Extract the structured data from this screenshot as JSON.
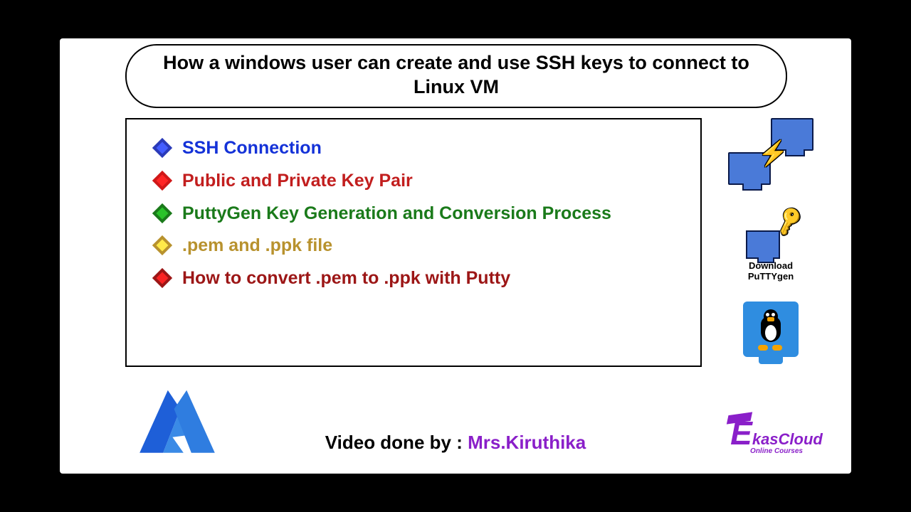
{
  "title": "How a windows user can create and use SSH keys to connect to Linux VM",
  "bullets": [
    {
      "text": "SSH Connection"
    },
    {
      "text": "Public and Private Key Pair"
    },
    {
      "text": "PuttyGen Key Generation and Conversion Process"
    },
    {
      "text": ".pem and .ppk file"
    },
    {
      "text": "How to convert .pem to .ppk with Putty"
    }
  ],
  "credit_label": "Video done by : ",
  "credit_author": "Mrs.Kiruthika",
  "puttygen_caption": "Download PuTTYgen",
  "brand_main": "kasCloud",
  "brand_e": "E",
  "brand_sub": "Online Courses"
}
